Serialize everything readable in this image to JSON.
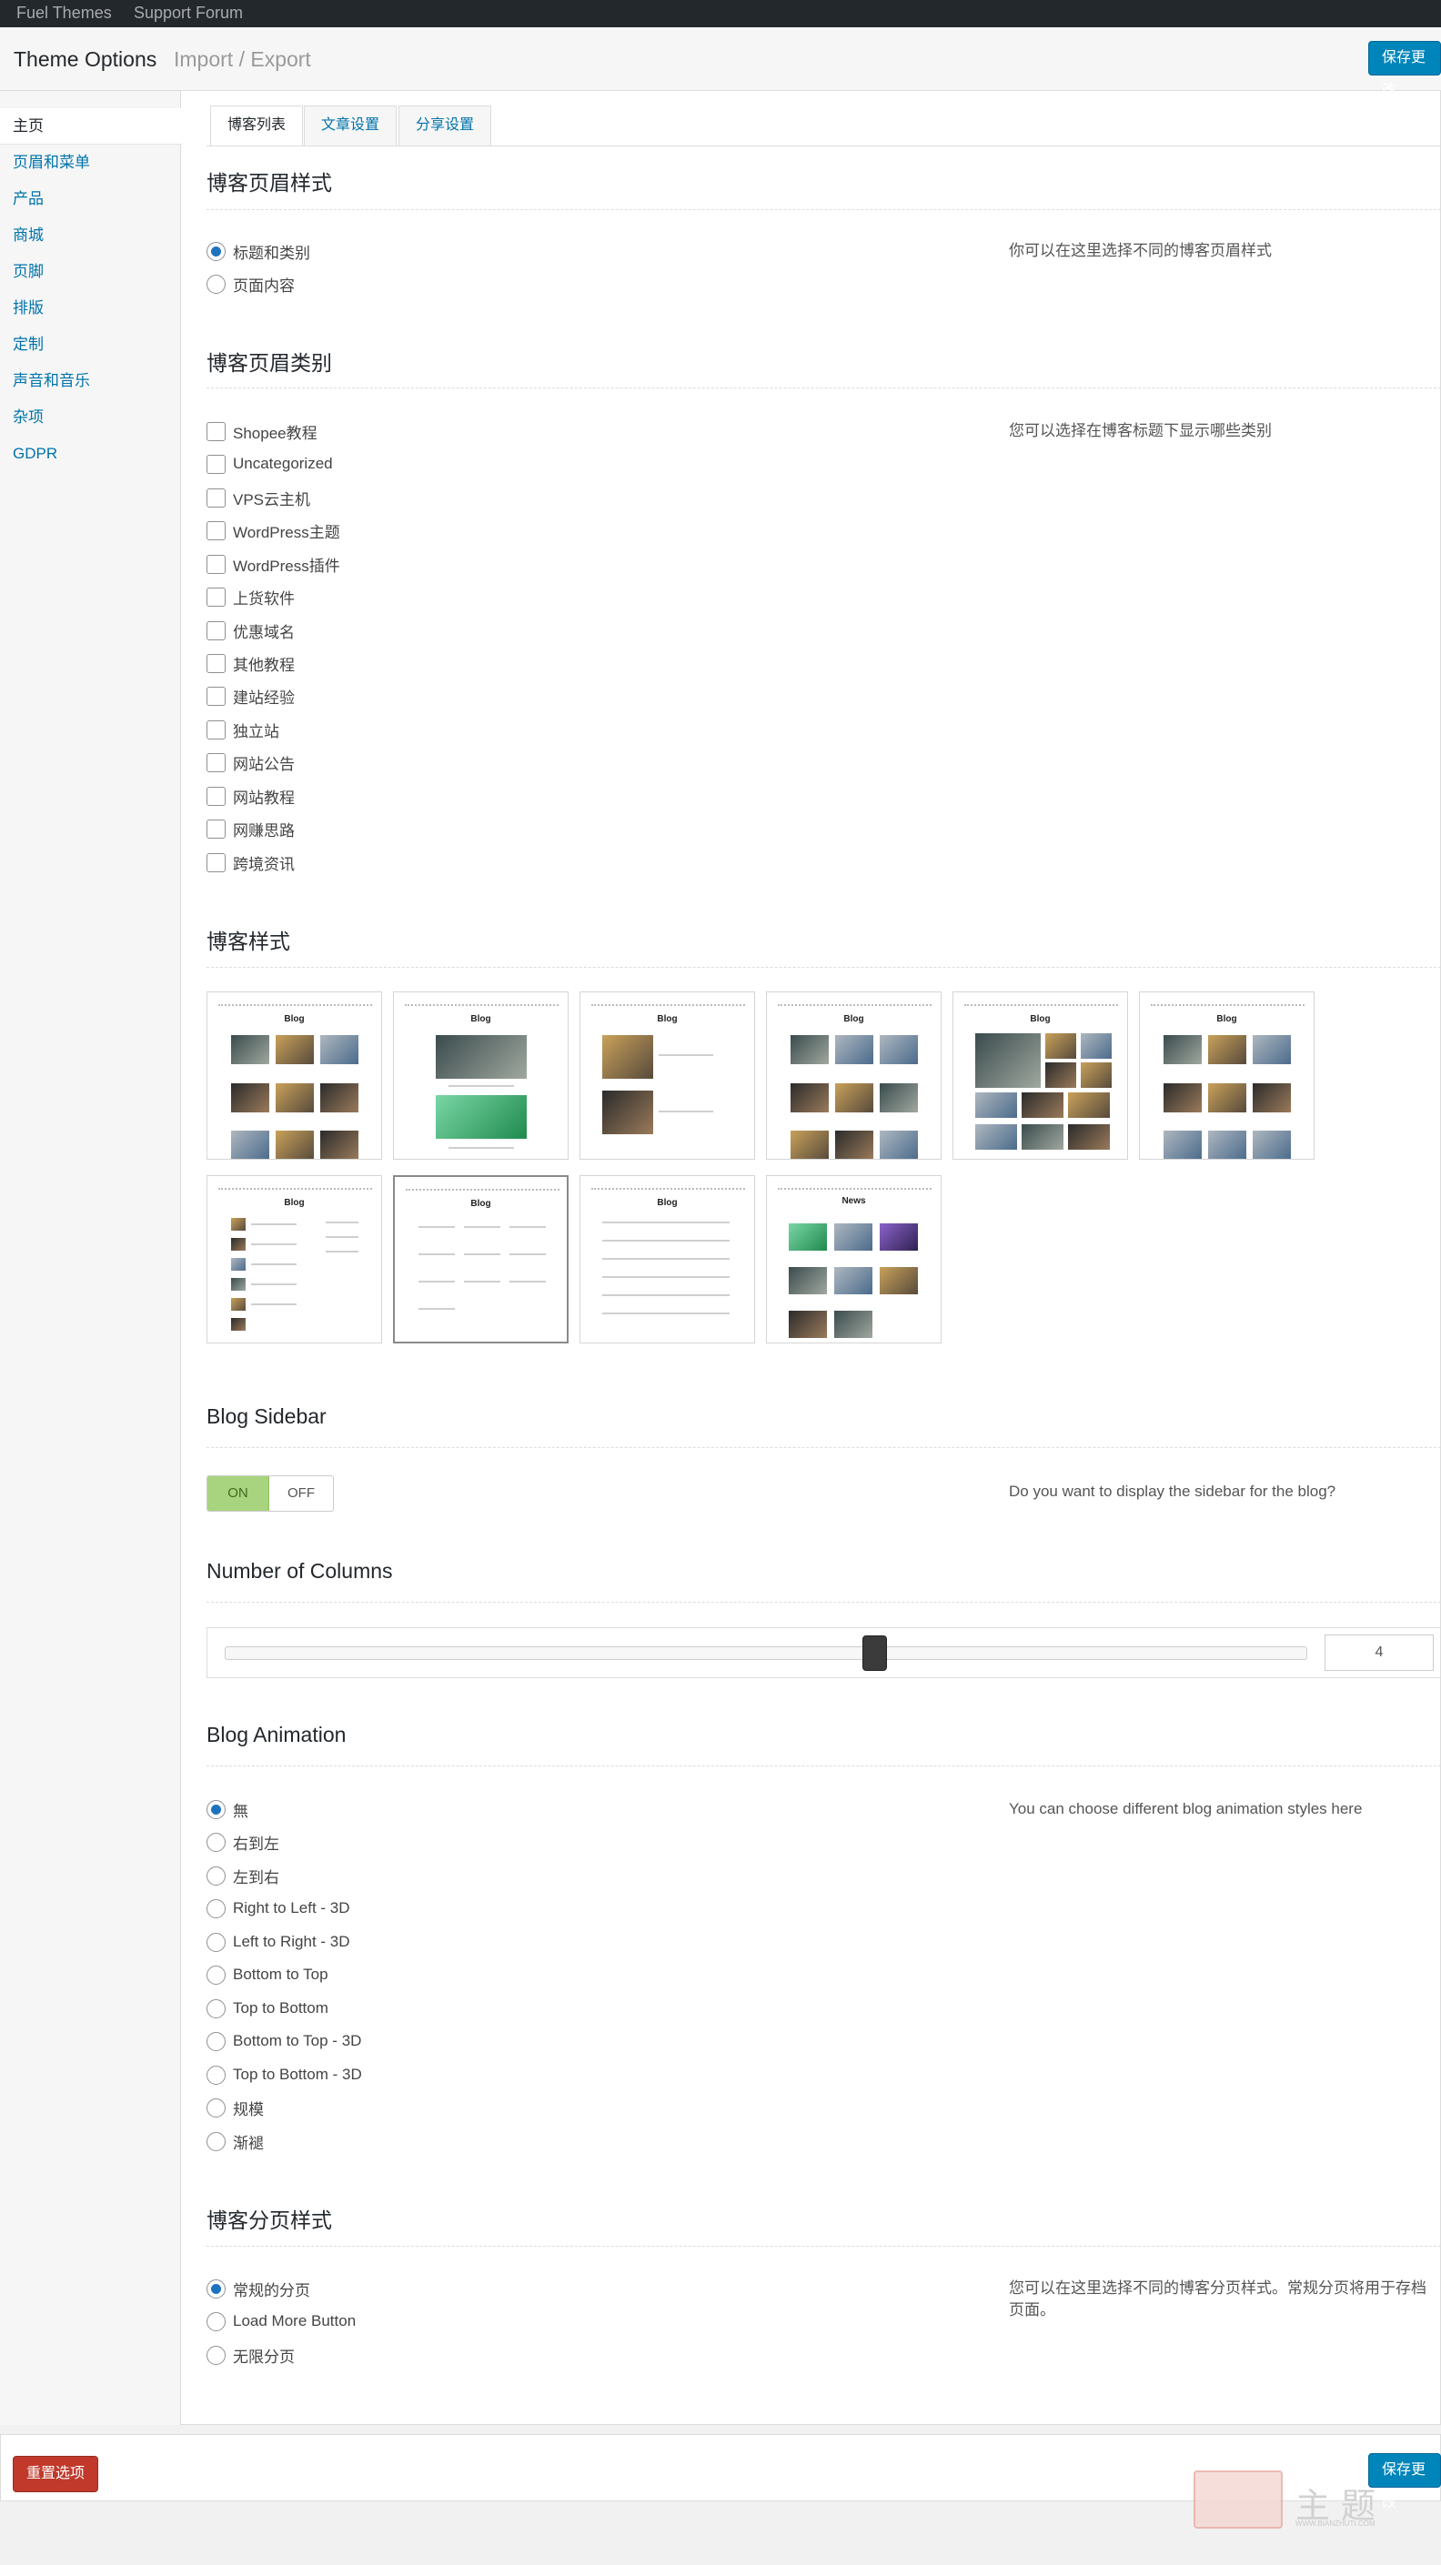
{
  "adminbar": {
    "item1": "Fuel Themes",
    "item2": "Support Forum"
  },
  "header": {
    "title": "Theme Options",
    "import_export": "Import / Export",
    "save_label": "保存更改"
  },
  "sidebar": {
    "items": [
      {
        "label": "主页",
        "active": true
      },
      {
        "label": "页眉和菜单"
      },
      {
        "label": "产品"
      },
      {
        "label": "商城"
      },
      {
        "label": "页脚"
      },
      {
        "label": "排版"
      },
      {
        "label": "定制"
      },
      {
        "label": "声音和音乐"
      },
      {
        "label": "杂项"
      },
      {
        "label": "GDPR"
      }
    ]
  },
  "tabs": [
    {
      "label": "博客列表",
      "active": true
    },
    {
      "label": "文章设置"
    },
    {
      "label": "分享设置"
    }
  ],
  "blog_header_style": {
    "title": "博客页眉样式",
    "description": "你可以在这里选择不同的博客页眉样式",
    "options": [
      "标题和类别",
      "页面内容"
    ],
    "selected": "标题和类别"
  },
  "blog_header_categories": {
    "title": "博客页眉类别",
    "description": "您可以选择在博客标题下显示哪些类别",
    "options": [
      "Shopee教程",
      "Uncategorized",
      "VPS云主机",
      "WordPress主题",
      "WordPress插件",
      "上货软件",
      "优惠域名",
      "其他教程",
      "建站经验",
      "独立站",
      "网站公告",
      "网站教程",
      "网赚思路",
      "跨境资讯"
    ]
  },
  "blog_style": {
    "title": "博客样式",
    "thumb_title": "Blog",
    "news_title": "News",
    "selected_index": 7
  },
  "blog_sidebar": {
    "title": "Blog Sidebar",
    "description": "Do you want to display the sidebar for the blog?",
    "on_label": "ON",
    "off_label": "OFF",
    "value": "ON"
  },
  "columns": {
    "title": "Number of Columns",
    "value": "4",
    "min": 1,
    "max": 6
  },
  "blog_animation": {
    "title": "Blog Animation",
    "description": "You can choose different blog animation styles here",
    "options": [
      "無",
      "右到左",
      "左到右",
      "Right to Left - 3D",
      "Left to Right - 3D",
      "Bottom to Top",
      "Top to Bottom",
      "Bottom to Top - 3D",
      "Top to Bottom - 3D",
      "规模",
      "渐褪"
    ],
    "selected": "無"
  },
  "pagination": {
    "title": "博客分页样式",
    "description_line1": "您可以在这里选择不同的博客分页样式。常规分页将用于存档",
    "description_line2": "页面。",
    "options": [
      "常规的分页",
      "Load More Button",
      "无限分页"
    ],
    "selected": "常规的分页"
  },
  "footer": {
    "reset_label": "重置选项",
    "save_label": "保存更改"
  },
  "watermark": {
    "chars": "主题",
    "url": "WWW.BIANZHUTI.COM"
  },
  "colors": {
    "accent": "#0085ba",
    "link": "#0073aa",
    "toggle_on": "#a9d47f",
    "reset": "#c0392b"
  }
}
